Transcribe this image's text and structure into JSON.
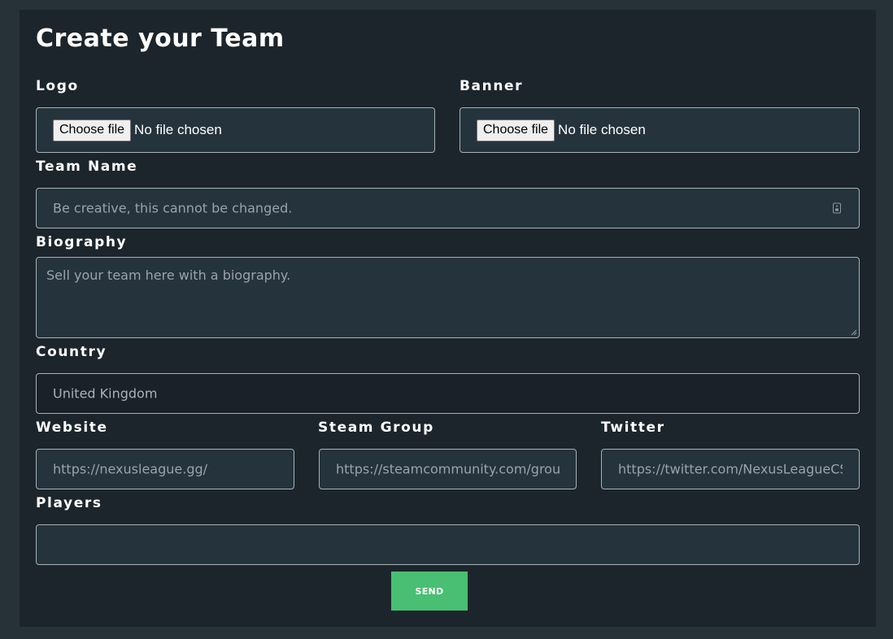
{
  "form": {
    "title": "Create your Team",
    "logo": {
      "label": "Logo",
      "button": "Choose file",
      "status": "No file chosen"
    },
    "banner": {
      "label": "Banner",
      "button": "Choose file",
      "status": "No file chosen"
    },
    "team_name": {
      "label": "Team Name",
      "placeholder": "Be creative, this cannot be changed."
    },
    "biography": {
      "label": "Biography",
      "placeholder": "Sell your team here with a biography."
    },
    "country": {
      "label": "Country",
      "value": "United Kingdom"
    },
    "website": {
      "label": "Website",
      "placeholder": "https://nexusleague.gg/"
    },
    "steam_group": {
      "label": "Steam Group",
      "placeholder": "https://steamcommunity.com/grou"
    },
    "twitter": {
      "label": "Twitter",
      "placeholder": "https://twitter.com/NexusLeagueCS"
    },
    "players": {
      "label": "Players",
      "value": ""
    },
    "send_label": "SEND"
  },
  "colors": {
    "page_bg": "#263238",
    "panel_bg": "#1c252b",
    "field_bg": "#25333c",
    "accent": "#48bf72"
  },
  "icons": {
    "team_name_field": "contact-card-icon",
    "textarea_resize": "resize-handle-icon"
  }
}
